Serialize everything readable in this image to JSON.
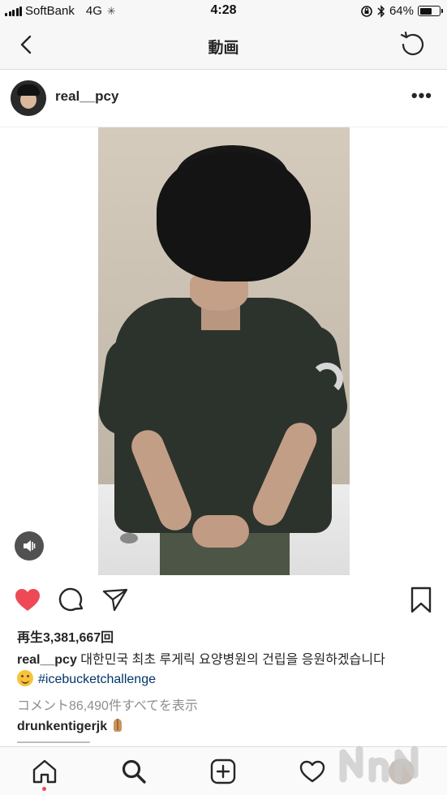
{
  "status_bar": {
    "carrier": "SoftBank",
    "network": "4G",
    "time": "4:28",
    "battery_percent_label": "64%",
    "battery_level": 0.64
  },
  "nav": {
    "title": "動画",
    "back_icon": "chevron-left-icon",
    "refresh_icon": "refresh-icon"
  },
  "post": {
    "username": "real__pcy",
    "more_icon": "more-horizontal-icon"
  },
  "video": {
    "mute_icon": "speaker-muted-icon"
  },
  "actions": {
    "like_icon": "heart-filled-icon",
    "like_color": "#ed4956",
    "comment_icon": "comment-bubble-icon",
    "share_icon": "paper-plane-icon",
    "save_icon": "bookmark-icon"
  },
  "views": "再生3,381,667回",
  "caption": {
    "username": "real__pcy",
    "text": "대한민국 최초 루게릭 요양병원의 건립을 응원하겠습니다",
    "emoji": "smiling-face-icon",
    "hashtag": "#icebucketchallenge"
  },
  "view_comments": "コメント86,490件すべてを表示",
  "comment": {
    "username": "drunkentigerjk",
    "emoji": "folded-hands-icon"
  },
  "tab_bar": {
    "home_icon": "home-icon",
    "search_icon": "search-icon",
    "add_icon": "add-post-icon",
    "activity_icon": "heart-outline-icon",
    "profile_icon": "profile-avatar-icon"
  },
  "hashtag_color": "#003569"
}
